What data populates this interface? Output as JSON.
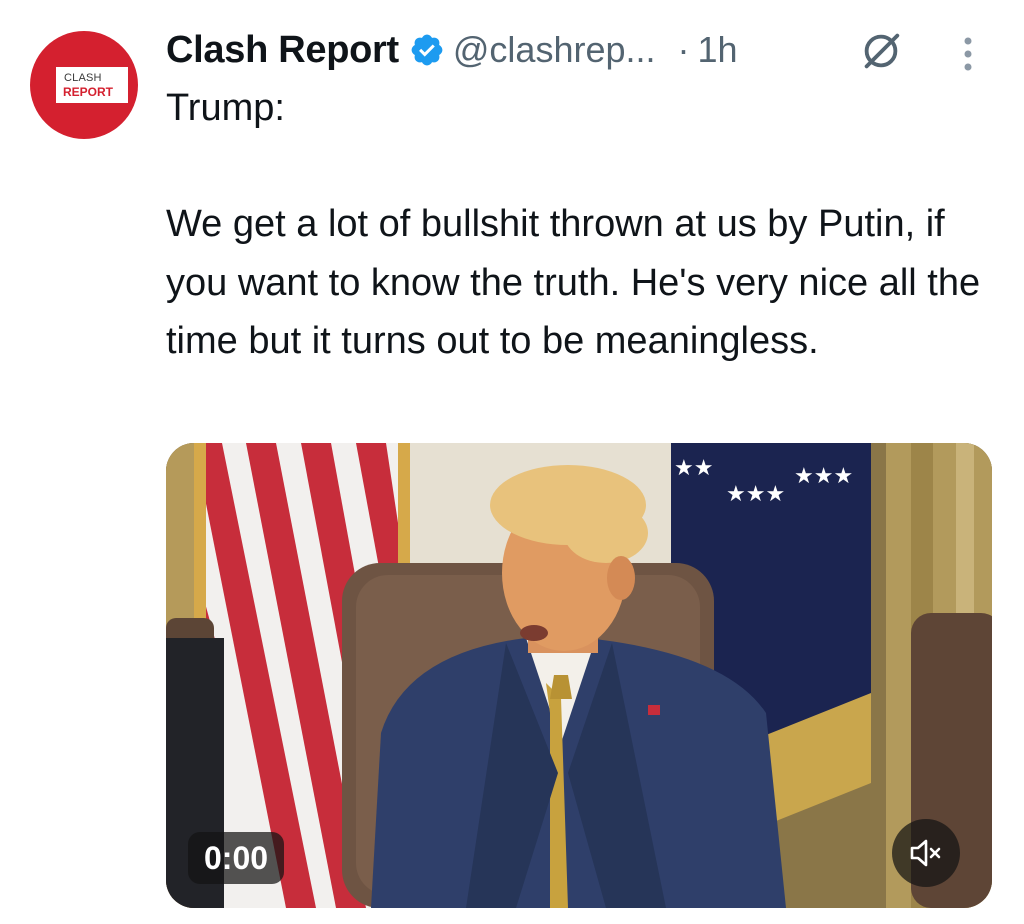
{
  "author": {
    "display_name": "Clash Report",
    "handle": "@clashrep...",
    "separator": "·",
    "time_ago": "1h",
    "avatar_text_top": "CLASH",
    "avatar_text_bottom": "REPORT",
    "avatar_color": "#d4202f",
    "verified_color": "#1d9bf0"
  },
  "tweet": {
    "lead": "Trump:",
    "body": "We get a lot of bullshit thrown at us by Putin, if you want to know the truth. He's very nice all the time but it turns out to be meaningless."
  },
  "media": {
    "type": "video",
    "timestamp": "0:00",
    "muted": true
  },
  "icons": {
    "grok": "grok-icon",
    "more": "more-options-icon",
    "verified": "verified-badge-icon",
    "mute": "muted-speaker-icon"
  }
}
